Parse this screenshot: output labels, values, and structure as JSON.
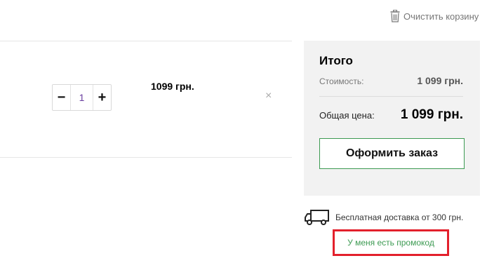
{
  "header": {
    "clear_cart_label": "Очистить корзину",
    "clear_cart_icon": "trash-icon"
  },
  "cart_item": {
    "quantity": "1",
    "minus_label": "−",
    "plus_label": "+",
    "price": "1099 грн.",
    "remove_label": "×"
  },
  "summary": {
    "title": "Итого",
    "cost_label": "Стоимость:",
    "cost_value": "1 099 грн.",
    "total_label": "Общая цена:",
    "total_value": "1 099 грн.",
    "checkout_label": "Оформить заказ"
  },
  "delivery": {
    "icon": "truck-icon",
    "text": "Бесплатная доставка от 300 грн."
  },
  "promo": {
    "link_label": "У меня есть промокод"
  },
  "colors": {
    "accent_green": "#3c9a52",
    "highlight_red": "#e3202c",
    "panel_bg": "#f2f2f2",
    "quantity_text": "#6a3fa0"
  }
}
